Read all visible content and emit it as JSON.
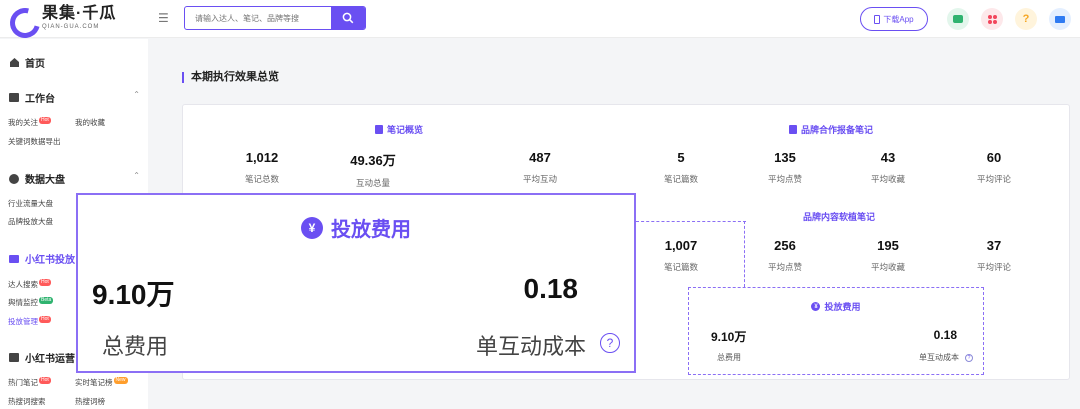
{
  "header": {
    "logo_cn": "果集·千瓜",
    "logo_en": "QIAN-GUA.COM",
    "search_placeholder": "请输入达人、笔记、品牌等搜",
    "download_label": "下载App",
    "help_label": "?"
  },
  "sidebar": {
    "home": "首页",
    "workbench": "工作台",
    "workbench_items": [
      "我的关注",
      "我的收藏",
      "关键词数据导出"
    ],
    "bigdata": "数据大盘",
    "bigdata_items": [
      "行业流量大盘",
      "品牌投放大盘"
    ],
    "xhs_launch": "小红书投放",
    "xhs_launch_items": [
      "达人搜索",
      "舆情监控",
      "投放管理"
    ],
    "xhs_ops": "小红书运营",
    "xhs_ops_items": [
      "热门笔记",
      "实时笔记榜",
      "热搜词搜索",
      "热搜词榜"
    ],
    "tags": {
      "hot": "Hot",
      "beta": "Beta",
      "new": "New"
    }
  },
  "main": {
    "title": "本期执行效果总览",
    "notes_overview": {
      "title": "笔记概览",
      "stats": [
        {
          "value": "1,012",
          "label": "笔记总数"
        },
        {
          "value": "49.36万",
          "label": "互动总量"
        },
        {
          "value": "487",
          "label": "平均互动"
        }
      ]
    },
    "brand_coop": {
      "title": "品牌合作报备笔记",
      "stats": [
        {
          "value": "5",
          "label": "笔记篇数"
        },
        {
          "value": "135",
          "label": "平均点赞"
        },
        {
          "value": "43",
          "label": "平均收藏"
        },
        {
          "value": "60",
          "label": "平均评论"
        }
      ]
    },
    "brand_content": {
      "title": "品牌内容软植笔记",
      "stats": [
        {
          "value": "1,007",
          "label": "笔记篇数"
        },
        {
          "value": "256",
          "label": "平均点赞"
        },
        {
          "value": "195",
          "label": "平均收藏"
        },
        {
          "value": "37",
          "label": "平均评论"
        }
      ]
    },
    "spend": {
      "title": "投放费用",
      "total_value": "9.10万",
      "total_label": "总费用",
      "unit_value": "0.18",
      "unit_label": "单互动成本"
    }
  },
  "colors": {
    "accent": "#6a4ff2",
    "hot": "#ff5a5a",
    "beta": "#2fb36f",
    "new": "#ff9e2c"
  }
}
